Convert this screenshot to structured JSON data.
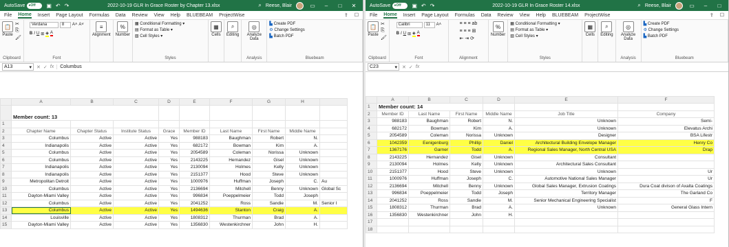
{
  "left": {
    "autosave_label": "AutoSave",
    "toggle_label": "Off",
    "filename": "2022-10-19 GLR In Grace Roster by Chapter 13.xlsx",
    "user": "Reese, Blair",
    "tabs": [
      "File",
      "Home",
      "Insert",
      "Page Layout",
      "Formulas",
      "Data",
      "Review",
      "View",
      "Help",
      "BLUEBEAM",
      "ProjectWise"
    ],
    "font_name": "Verdana",
    "font_size": "8",
    "groups": {
      "clipboard": "Clipboard",
      "font": "Font",
      "styles": "Styles",
      "analysis": "Analysis",
      "bluebeam": "Bluebeam",
      "paste": "Paste",
      "alignment": "Alignment",
      "number": "Number",
      "cells": "Cells",
      "editing": "Editing",
      "analyze": "Analyze Data",
      "cond_format": "Conditional Formatting",
      "format_table": "Format as Table",
      "cell_styles": "Cell Styles",
      "create_pdf": "Create PDF",
      "change_settings": "Change Settings",
      "batch_pdf": "Batch PDF"
    },
    "namebox": "A13",
    "formula": "Columbus",
    "col_letters": [
      "A",
      "B",
      "C",
      "D",
      "E",
      "F",
      "G",
      "H",
      ""
    ],
    "member_count": "Member count: 13",
    "headers": [
      "Chapter Name",
      "Chapter Status",
      "Institute Status",
      "Grace",
      "Member ID",
      "Last Name",
      "First Name",
      "Middle Name",
      ""
    ],
    "rows": [
      [
        "Columbus",
        "Active",
        "Active",
        "Yes",
        "988183",
        "Baughman",
        "Robert",
        "N.",
        ""
      ],
      [
        "Indianapolis",
        "Active",
        "Active",
        "Yes",
        "682172",
        "Bowman",
        "Kim",
        "A.",
        ""
      ],
      [
        "Columbus",
        "Active",
        "Active",
        "Yes",
        "2054589",
        "Coleman",
        "Norissa",
        "Unknown",
        ""
      ],
      [
        "Columbus",
        "Active",
        "Active",
        "Yes",
        "2143225",
        "Hernandez",
        "Gisel",
        "Unknown",
        ""
      ],
      [
        "Indianapolis",
        "Active",
        "Active",
        "Yes",
        "2130094",
        "Holmes",
        "Kelly",
        "Unknown",
        ""
      ],
      [
        "Indianapolis",
        "Active",
        "Active",
        "Yes",
        "2151377",
        "Hood",
        "Steve",
        "Unknown",
        ""
      ],
      [
        "Metropolitan Detroit",
        "Active",
        "Active",
        "Yes",
        "1000976",
        "Huffman",
        "Joseph",
        "C.",
        "Au"
      ],
      [
        "Columbus",
        "Active",
        "Active",
        "Yes",
        "2136694",
        "Mitchell",
        "Benny",
        "Unknown",
        "Global Sc"
      ],
      [
        "Dayton-Miami Valley",
        "Active",
        "Active",
        "Yes",
        "996834",
        "Poeppelmeier",
        "Todd",
        "Joseph",
        ""
      ],
      [
        "Columbus",
        "Active",
        "Active",
        "Yes",
        "2041252",
        "Ross",
        "Sandie",
        "M.",
        "Senior I"
      ],
      [
        "Columbus",
        "Active",
        "Active",
        "Yes",
        "1494636",
        "Stanton",
        "Craig",
        "A.",
        ""
      ],
      [
        "Louisville",
        "Active",
        "Active",
        "Yes",
        "1808312",
        "Thurman",
        "Brad",
        "A.",
        ""
      ],
      [
        "Dayton-Miami Valley",
        "Active",
        "Active",
        "Yes",
        "1356830",
        "Westenkirchner",
        "John",
        "H.",
        ""
      ]
    ]
  },
  "right": {
    "autosave_label": "AutoSave",
    "toggle_label": "Off",
    "filename": "2022-10-19 GLR In Grace Roster 14.xlsx",
    "user": "Reese, Blair",
    "tabs": [
      "File",
      "Home",
      "Insert",
      "Page Layout",
      "Formulas",
      "Data",
      "Review",
      "View",
      "Help",
      "BLUEBEAM",
      "ProjectWise"
    ],
    "font_name": "Calibri",
    "font_size": "11",
    "groups": {
      "clipboard": "Clipboard",
      "font": "Font",
      "alignment": "Alignment",
      "styles": "Styles",
      "analysis": "Analysis",
      "bluebeam": "Bluebeam",
      "paste": "Paste",
      "number": "Number",
      "cells": "Cells",
      "editing": "Editing",
      "analyze": "Analyze Data",
      "cond_format": "Conditional Formatting",
      "format_table": "Format as Table",
      "cell_styles": "Cell Styles",
      "create_pdf": "Create PDF",
      "change_settings": "Change Settings",
      "batch_pdf": "Batch PDF"
    },
    "namebox": "C23",
    "formula": "",
    "col_letters": [
      "A",
      "B",
      "C",
      "D",
      "E",
      "F"
    ],
    "member_count": "Member count: 14",
    "headers": [
      "Member ID",
      "Last Name",
      "First Name",
      "Middle Name",
      "Job Title",
      "Company"
    ],
    "rows": [
      [
        "988183",
        "Baughman",
        "Robert",
        "N.",
        "Unknown",
        "Semi-"
      ],
      [
        "682172",
        "Bowman",
        "Kim",
        "A.",
        "Unknown",
        "Elevatus Archi"
      ],
      [
        "2054589",
        "Coleman",
        "Norissa",
        "Unknown",
        "Designer",
        "BSA Lifestr"
      ],
      [
        "1042359",
        "Eenigenburg",
        "Phillip",
        "Daniel",
        "Architectural Building Envelope Manager",
        "Henry Co"
      ],
      [
        "1367176",
        "Garner",
        "Todd",
        "A.",
        "Regional Sales Manager, North Central USA",
        "Drap"
      ],
      [
        "2143225",
        "Hernandez",
        "Gisel",
        "Unknown",
        "Consultant",
        ""
      ],
      [
        "2130094",
        "Holmes",
        "Kelly",
        "Unknown",
        "Architectural Sales Consultant",
        ""
      ],
      [
        "2151377",
        "Hood",
        "Steve",
        "Unknown",
        "Unknown",
        "Ur"
      ],
      [
        "1000976",
        "Huffman",
        "Joseph",
        "C.",
        "Automotive National Sales Manager",
        "Ur"
      ],
      [
        "2136694",
        "Mitchell",
        "Benny",
        "Unknown",
        "Global Sales Manager, Extrusion Coatings",
        "Dura Coat divison of Axalta Coatings"
      ],
      [
        "996834",
        "Poeppelmeier",
        "Todd",
        "Joseph",
        "Territory Manager",
        "The Garland Co"
      ],
      [
        "2041252",
        "Ross",
        "Sandie",
        "M.",
        "Senior Mechanical Engineering Specialist",
        "F"
      ],
      [
        "1808312",
        "Thurman",
        "Brad",
        "A.",
        "Unknown",
        "General Glass Intern"
      ],
      [
        "1356830",
        "Westenkirchner",
        "John",
        "H.",
        "",
        ""
      ]
    ]
  },
  "colors": {
    "excel_green": "#217346",
    "highlight": "#ffff44"
  }
}
